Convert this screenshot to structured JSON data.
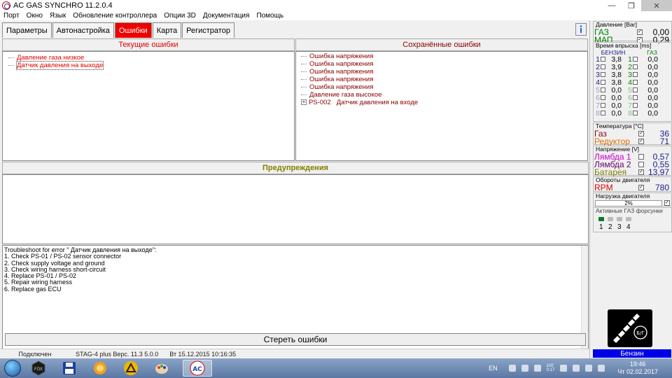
{
  "window": {
    "title": "AC GAS SYNCHRO  11.2.0.4",
    "minimize": "—",
    "maximize": "❐",
    "close": "✕"
  },
  "menu": [
    "Порт",
    "Окно",
    "Язык",
    "Обновление контроллера",
    "Опции 3D",
    "Документация",
    "Помощь"
  ],
  "tabs": [
    {
      "label": "Параметры",
      "active": false
    },
    {
      "label": "Автонастройка",
      "active": false
    },
    {
      "label": "Ошибки",
      "active": true
    },
    {
      "label": "Карта",
      "active": false
    },
    {
      "label": "Регистратор",
      "active": false
    }
  ],
  "current_errors": {
    "title": "Текущие ошибки",
    "items": [
      "Давление газа низкое",
      "Датчик давления на выходе"
    ]
  },
  "saved_errors": {
    "title": "Сохранённые ошибки",
    "items": [
      "Ошибка напряжения",
      "Ошибка напряжения",
      "Ошибка напряжения",
      "Ошибка напряжения",
      "Ошибка напряжения",
      "Давление газа высокое"
    ],
    "expandable": {
      "code": "PS-002",
      "label": "Датчик давления на входе"
    }
  },
  "warnings": {
    "title": "Предупреждения"
  },
  "troubleshoot": [
    "Troubleshoot for error \" Датчик давления на выходе\":",
    "1. Check PS-01 / PS-02 sensor connector",
    "2. Check supply voltage and ground",
    "3. Check wiring harness short-circuit",
    "4. Replace PS-01 / PS-02",
    "5. Repair wiring harness",
    "6. Replace gas ECU"
  ],
  "clear_button": "Стереть ошибки",
  "status": {
    "connection": "Подключен",
    "version": "STAG-4 plus   Верс. 11.3  5.0.0",
    "date": "Вт 15.12.2015 10:16:35"
  },
  "sidebar": {
    "pressure": {
      "title": "Давление [Bar]",
      "rows": [
        {
          "label": "ГАЗ",
          "value": "0,00",
          "color": "#008000"
        },
        {
          "label": "МАП",
          "value": "0,29",
          "color": "#008000"
        }
      ]
    },
    "injection": {
      "title": "Время впрыска [ms]",
      "petrol_label": "БЕНЗИН",
      "gas_label": "ГАЗ",
      "rows": [
        {
          "n": "1",
          "petrol": "3,8",
          "gas": "0,0",
          "active": true
        },
        {
          "n": "2",
          "petrol": "3,9",
          "gas": "0,0",
          "active": true
        },
        {
          "n": "3",
          "petrol": "3,8",
          "gas": "0,0",
          "active": true
        },
        {
          "n": "4",
          "petrol": "3,8",
          "gas": "0,0",
          "active": true
        },
        {
          "n": "5",
          "petrol": "0,0",
          "gas": "0,0",
          "active": false
        },
        {
          "n": "6",
          "petrol": "0,0",
          "gas": "0,0",
          "active": false
        },
        {
          "n": "7",
          "petrol": "0,0",
          "gas": "0,0",
          "active": false
        },
        {
          "n": "8",
          "petrol": "0,0",
          "gas": "0,0",
          "active": false
        }
      ]
    },
    "temperature": {
      "title": "Температура [°C]",
      "rows": [
        {
          "label": "Газ",
          "value": "36",
          "color": "#8b0000"
        },
        {
          "label": "Редуктор",
          "value": "71",
          "color": "#e07000"
        }
      ]
    },
    "voltage": {
      "title": "Напряжение [V]",
      "rows": [
        {
          "label": "Лямбда 1",
          "value": "0,57",
          "color": "#cc00cc"
        },
        {
          "label": "Лямбда 2",
          "value": "0,55",
          "color": "#660066"
        },
        {
          "label": "Батарея",
          "value": "13,97",
          "color": "#808000"
        }
      ]
    },
    "rpm": {
      "title": "Обороты двигателя",
      "label": "RPM",
      "value": "780"
    },
    "load": {
      "title": "Нагрузка двигателя",
      "value": "2%"
    },
    "gas_injectors": {
      "title": "Активные ГАЗ форсунки",
      "numbers": [
        "1",
        "2",
        "3",
        "4"
      ]
    },
    "logo_text": "Б/Г",
    "fuel": "Бензин"
  },
  "taskbar": {
    "lang": "EN",
    "net": "100\n0:17",
    "time": "19:46",
    "date": "Чт 02.02.2017"
  }
}
